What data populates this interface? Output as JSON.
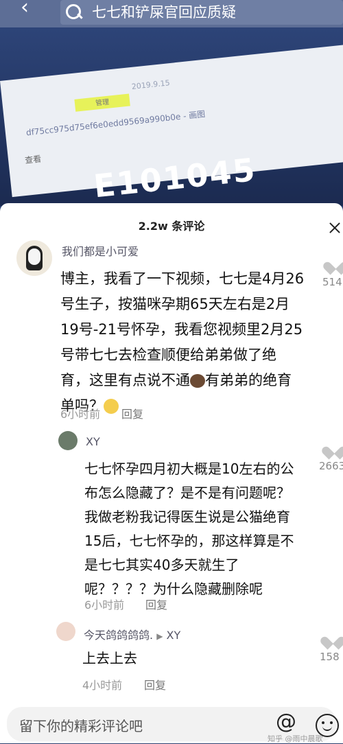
{
  "search": {
    "query": "七七和铲屎官回应质疑"
  },
  "video": {
    "date": "2019.9.15",
    "tag": "管理",
    "hash": "df75cc975d75ef6e0edd9569a990b0e",
    "hash_suffix": "- 画图",
    "view_label": "查看",
    "big_number": "E101045"
  },
  "panel": {
    "title": "2.2w 条评论"
  },
  "comments": [
    {
      "user": "我们都是小可爱",
      "lines": [
        "博主，我看了一下视频，七七是4月26",
        "号生子，按猫咪孕期65天左右是2月",
        "19号-21号怀孕，我看您视频里2月25",
        "号带七七去检查顺便给弟弟做了绝",
        "育，这里有点说不通",
        "有弟弟的绝育",
        "单吗？"
      ],
      "time": "6小时前",
      "reply_label": "回复",
      "likes": "514"
    },
    {
      "user": "XY",
      "lines": [
        "七七怀孕四月初大概是10左右的公",
        "布怎么隐藏了？是不是有问题呢？",
        "我做老粉我记得医生说是公猫绝育",
        "15后，七七怀孕的，那这样算是不",
        "是七七其实40多天就生了",
        "呢？？？？为什么隐藏删除呢"
      ],
      "time": "6小时前",
      "reply_label": "回复",
      "likes": "2663"
    },
    {
      "user": "今天鸽鸽鸽鸽.",
      "reply_to": "XY",
      "lines": [
        "上去上去"
      ],
      "time": "4小时前",
      "reply_label": "回复",
      "likes": "158"
    }
  ],
  "input": {
    "placeholder": "留下你的精彩评论吧"
  },
  "watermark": "知乎 @雨中晨歌"
}
